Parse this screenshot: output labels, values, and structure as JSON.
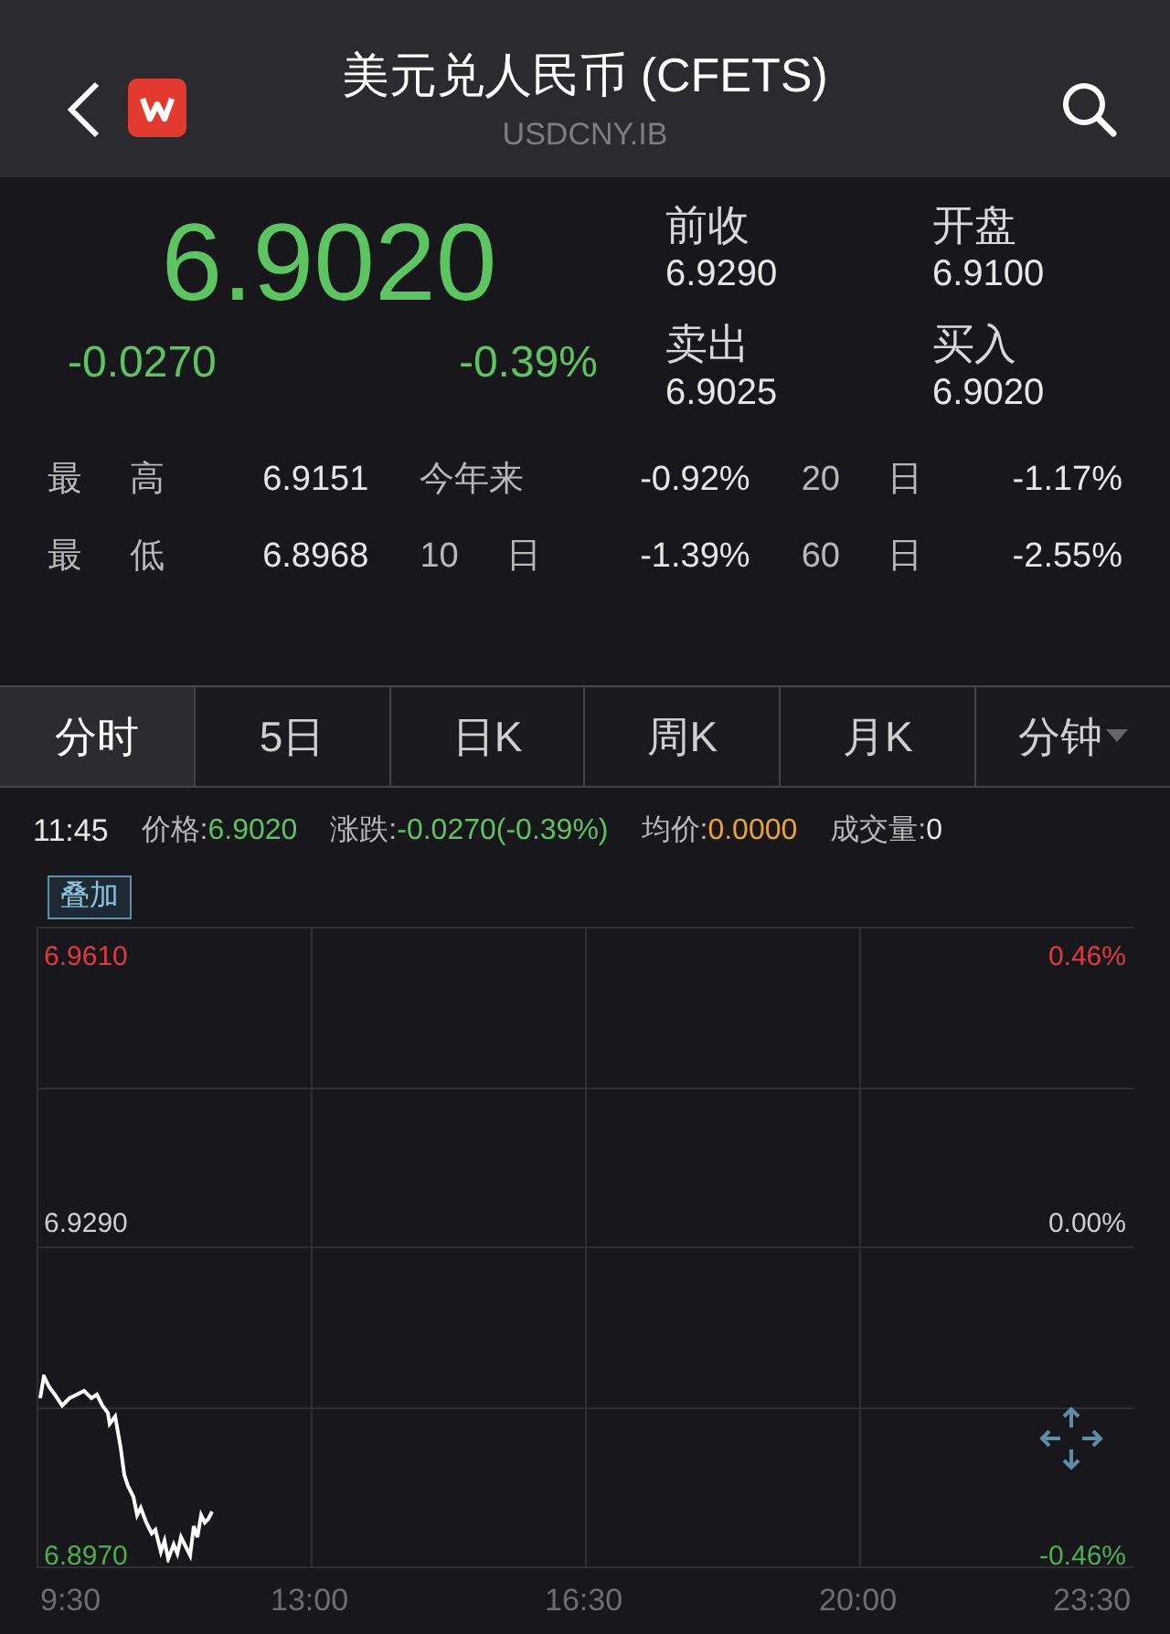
{
  "header": {
    "title": "美元兑人民币 (CFETS)",
    "symbol": "USDCNY.IB"
  },
  "quote": {
    "price": "6.9020",
    "change": "-0.0270",
    "change_pct": "-0.39%",
    "fields": [
      {
        "label": "前收",
        "value": "6.9290"
      },
      {
        "label": "开盘",
        "value": "6.9100"
      },
      {
        "label": "卖出",
        "value": "6.9025"
      },
      {
        "label": "买入",
        "value": "6.9020"
      }
    ]
  },
  "stats": [
    [
      {
        "label": "最 高",
        "value": "6.9151"
      },
      {
        "label": "今年来",
        "value": "-0.92%"
      },
      {
        "label": "20 日",
        "value": "-1.17%"
      }
    ],
    [
      {
        "label": "最 低",
        "value": "6.8968"
      },
      {
        "label": "10 日",
        "value": "-1.39%"
      },
      {
        "label": "60 日",
        "value": "-2.55%"
      }
    ]
  ],
  "tabs": [
    {
      "label": "分时",
      "selected": true,
      "kind": "plain"
    },
    {
      "label": "5日",
      "selected": false,
      "kind": "plain"
    },
    {
      "label": "日K",
      "selected": false,
      "kind": "plain"
    },
    {
      "label": "周K",
      "selected": false,
      "kind": "plain"
    },
    {
      "label": "月K",
      "selected": false,
      "kind": "plain"
    },
    {
      "label": "分钟",
      "selected": false,
      "kind": "dropdown"
    }
  ],
  "info_bar": {
    "time": "11:45",
    "items": [
      {
        "label": "价格:",
        "value": "6.9020",
        "color": "#5cc461"
      },
      {
        "label": "涨跌:",
        "value": "-0.0270(-0.39%)",
        "color": "#5cc461"
      },
      {
        "label": "均价:",
        "value": "0.0000",
        "color": "#e8a33c"
      },
      {
        "label": "成交量:",
        "value": "0",
        "color": "#e6e6e6"
      }
    ]
  },
  "overlay_button": "叠加",
  "chart": {
    "left_labels": [
      {
        "text": "6.9610",
        "color": "#e0393e"
      },
      {
        "text": "6.9290",
        "color": "#cfcfcf"
      },
      {
        "text": "6.8970",
        "color": "#4caf50"
      }
    ],
    "right_labels": [
      {
        "text": "0.46%",
        "color": "#e0393e"
      },
      {
        "text": "0.00%",
        "color": "#cfcfcf"
      },
      {
        "text": "-0.46%",
        "color": "#4caf50"
      }
    ],
    "x_labels": [
      "9:30",
      "13:00",
      "16:30",
      "20:00",
      "23:30"
    ]
  }
}
